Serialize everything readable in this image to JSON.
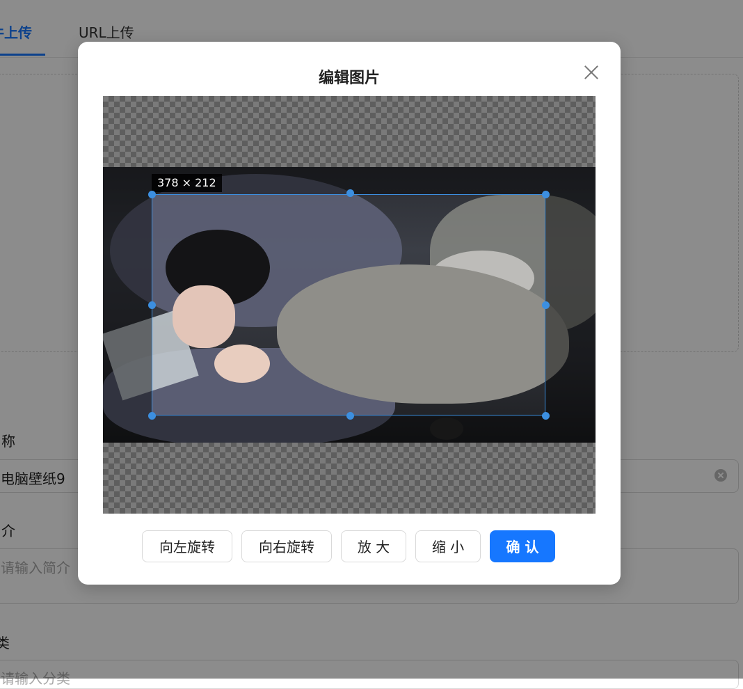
{
  "background": {
    "tabs": [
      {
        "label": "件上传",
        "active": true
      },
      {
        "label": "URL上传",
        "active": false
      }
    ],
    "form": {
      "name_label": "称",
      "name_value": "电脑壁纸9",
      "desc_label": "介",
      "desc_placeholder": "请输入简介",
      "category_label": "类",
      "category_placeholder": "请输入分类"
    }
  },
  "modal": {
    "title": "编辑图片",
    "crop_size": "378 × 212",
    "buttons": {
      "rotate_left": "向左旋转",
      "rotate_right": "向右旋转",
      "zoom_in": "放 大",
      "zoom_out": "缩 小",
      "confirm": "确 认"
    }
  },
  "colors": {
    "accent": "#1677ff",
    "crop_handle": "#3c8fe0",
    "mask": "rgba(0,0,0,0.45)"
  },
  "icons": {
    "close": "close-icon",
    "clear": "clear-icon"
  }
}
